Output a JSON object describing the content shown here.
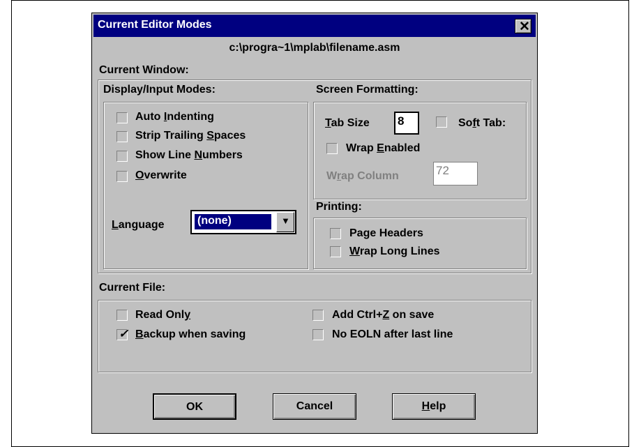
{
  "window": {
    "title": "Current Editor Modes",
    "close_glyph": "✕",
    "file_path": "c:\\progra~1\\mplab\\filename.asm"
  },
  "current_window": {
    "heading": "Current Window:",
    "display_input": {
      "heading": "Display/Input Modes:",
      "options": [
        {
          "pre": "Auto ",
          "key": "I",
          "post": "ndenting",
          "checked": false
        },
        {
          "pre": "Strip Trailing ",
          "key": "S",
          "post": "paces",
          "checked": false
        },
        {
          "pre": "Show Line ",
          "key": "N",
          "post": "umbers",
          "checked": false
        },
        {
          "pre": "",
          "key": "O",
          "post": "verwrite",
          "checked": false
        }
      ],
      "language_label_key": "L",
      "language_label_rest": "anguage",
      "language_value": "(none)",
      "dropdown_glyph": "▼"
    },
    "screen_formatting": {
      "heading": "Screen Formatting:",
      "tab_size_key": "T",
      "tab_size_rest": "ab Size",
      "tab_size_value": "8",
      "soft_tab_pre": "So",
      "soft_tab_key": "f",
      "soft_tab_post": "t Tab:",
      "wrap_enabled_pre": "Wrap ",
      "wrap_enabled_key": "E",
      "wrap_enabled_post": "nabled",
      "wrap_column_pre": "W",
      "wrap_column_key": "r",
      "wrap_column_post": "ap Column",
      "wrap_column_value": "72"
    },
    "printing": {
      "heading": "Printing:",
      "page_headers_pre": "Pa",
      "page_headers_key": "g",
      "page_headers_post": "e Headers",
      "wrap_long_key": "W",
      "wrap_long_post": "rap Long Lines"
    }
  },
  "current_file": {
    "heading": "Current File:",
    "read_only_pre": "Read Onl",
    "read_only_key": "y",
    "backup_key": "B",
    "backup_post": "ackup when saving",
    "backup_checked": true,
    "check_glyph": "✓",
    "ctrlz_pre": "Add Ctrl+",
    "ctrlz_key": "Z",
    "ctrlz_post": " on save",
    "no_eoln": "No EOLN after last line"
  },
  "buttons": {
    "ok": "OK",
    "cancel": "Cancel",
    "help_key": "H",
    "help_rest": "elp"
  }
}
